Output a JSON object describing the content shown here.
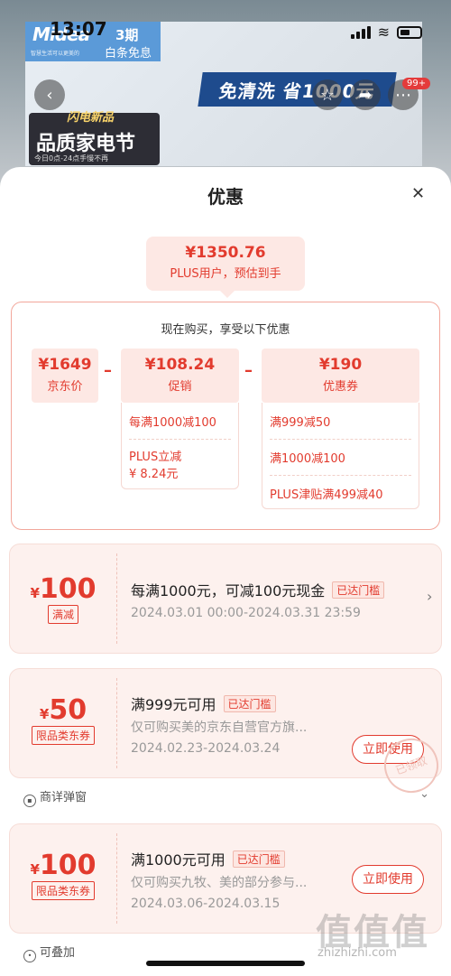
{
  "status": {
    "time": "13:07"
  },
  "banner": {
    "brand": "Midea",
    "brand_sub": "智慧生活可以更美的",
    "promo_line1": "3期",
    "promo_line2": "白条免息",
    "strip": "免清洗 省1000元",
    "festival_top": "闪电新品",
    "festival_main": "品质家电节",
    "festival_note": "今日0点-24点手慢不再",
    "badge": "99+"
  },
  "sheet": {
    "title": "优惠",
    "estimate": {
      "price": "¥1350.76",
      "label": "PLUS用户，预估到手"
    },
    "calc_head": "现在购买，享受以下优惠",
    "jd_price": {
      "value": "¥1649",
      "label": "京东价"
    },
    "promo": {
      "value": "¥108.24",
      "label": "促销",
      "items": [
        "每满1000减100",
        "PLUS立减\n¥ 8.24元"
      ]
    },
    "coupon": {
      "value": "¥190",
      "label": "优惠券",
      "items": [
        "满999减50",
        "满1000减100",
        "PLUS津贴满499减40"
      ]
    }
  },
  "cards": [
    {
      "amount": "100",
      "currency": "¥",
      "tag": "满减",
      "headline": "每满1000元，可减100元现金",
      "reached": "已达门槛",
      "desc": "",
      "dates": "2024.03.01 00:00-2024.03.31 23:59"
    },
    {
      "amount": "50",
      "currency": "¥",
      "tag": "限品类东券",
      "headline": "满999元可用",
      "reached": "已达门槛",
      "desc": "仅可购买美的京东自营官方旗...",
      "dates": "2024.02.23-2024.03.24",
      "button": "立即使用",
      "footer": "商详弹窗",
      "stamp": "已领取"
    },
    {
      "amount": "100",
      "currency": "¥",
      "tag": "限品类东券",
      "headline": "满1000元可用",
      "reached": "已达门槛",
      "desc": "仅可购买九牧、美的部分参与...",
      "dates": "2024.03.06-2024.03.15",
      "button": "立即使用",
      "footer": "可叠加"
    }
  ],
  "watermark": {
    "glyphs": "值值值",
    "site": "zhizhizhi.com"
  }
}
